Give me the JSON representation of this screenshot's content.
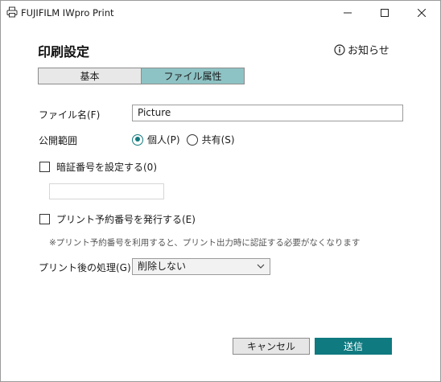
{
  "window": {
    "title": "FUJIFILM IWpro Print"
  },
  "header": {
    "title": "印刷設定",
    "notice": "お知らせ"
  },
  "tabs": [
    {
      "label": "基本",
      "active": false
    },
    {
      "label": "ファイル属性",
      "active": true
    }
  ],
  "form": {
    "filename_label": "ファイル名(F)",
    "filename_value": "Picture",
    "scope_label": "公開範囲",
    "scope_options": [
      {
        "label": "個人(P)",
        "checked": true
      },
      {
        "label": "共有(S)",
        "checked": false
      }
    ],
    "pin_checkbox_label": "暗証番号を設定する(0)",
    "pin_checked": false,
    "pin_value": "",
    "reservation_checkbox_label": "プリント予約番号を発行する(E)",
    "reservation_checked": false,
    "reservation_hint": "※プリント予約番号を利用すると、プリント出力時に認証する必要がなくなります",
    "after_print_label": "プリント後の処理(G)",
    "after_print_value": "削除しない"
  },
  "buttons": {
    "cancel": "キャンセル",
    "send": "送信"
  },
  "colors": {
    "accent": "#0f7a80",
    "tab_active": "#8ec3c5",
    "tab_inactive": "#e8e8e8"
  }
}
